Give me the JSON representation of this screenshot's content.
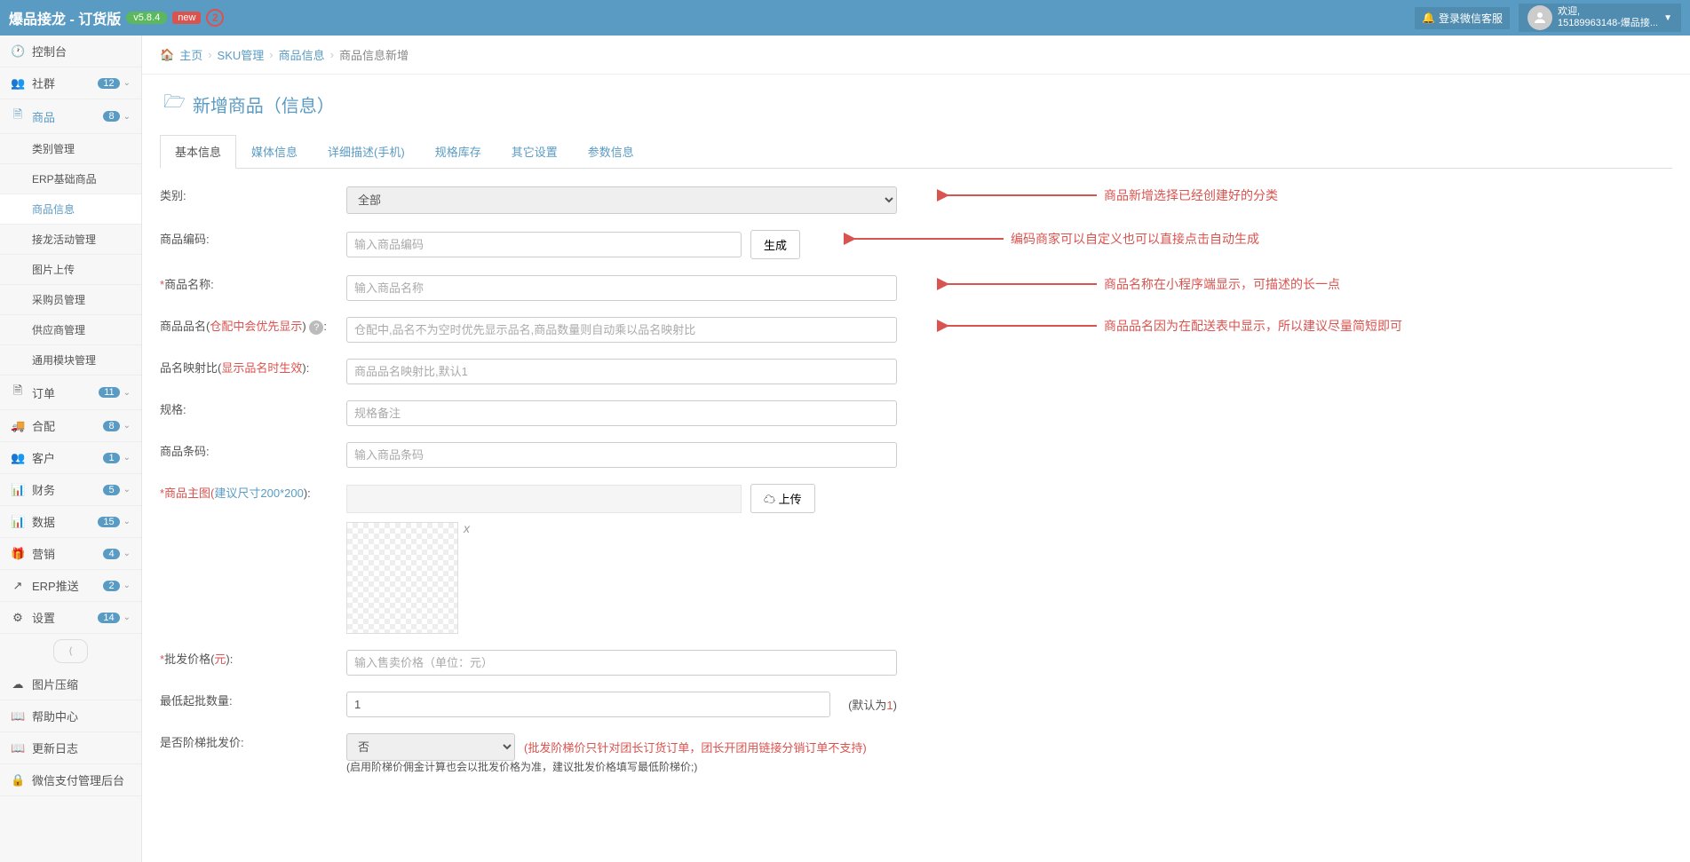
{
  "header": {
    "brand": "爆品接龙 - 订货版",
    "version": "v5.8.4",
    "new": "new",
    "notifCount": "2",
    "loginServiceBtn": "登录微信客服",
    "welcome": "欢迎,",
    "userSub": "15189963148-爆品接..."
  },
  "sidebar": {
    "items": [
      {
        "icon": "⏱",
        "label": "控制台"
      },
      {
        "icon": "👥",
        "label": "社群",
        "badge": "12"
      },
      {
        "icon": "🗎",
        "label": "商品",
        "badge": "8",
        "activeGroup": true
      },
      {
        "icon": "🗎",
        "label": "订单",
        "badge": "11"
      },
      {
        "icon": "🚚",
        "label": "合配",
        "badge": "8"
      },
      {
        "icon": "👥",
        "label": "客户",
        "badge": "1"
      },
      {
        "icon": "📊",
        "label": "财务",
        "badge": "5"
      },
      {
        "icon": "📊",
        "label": "数据",
        "badge": "15"
      },
      {
        "icon": "🎁",
        "label": "营销",
        "badge": "4"
      },
      {
        "icon": "↗",
        "label": "ERP推送",
        "badge": "2"
      },
      {
        "icon": "⚙",
        "label": "设置",
        "badge": "14"
      }
    ],
    "subItems": [
      "类别管理",
      "ERP基础商品",
      "商品信息",
      "接龙活动管理",
      "图片上传",
      "采购员管理",
      "供应商管理",
      "通用模块管理"
    ],
    "bottom": [
      {
        "icon": "☁",
        "label": "图片压缩"
      },
      {
        "icon": "📖",
        "label": "帮助中心"
      },
      {
        "icon": "📖",
        "label": "更新日志"
      },
      {
        "icon": "🔒",
        "label": "微信支付管理后台"
      }
    ]
  },
  "breadcrumb": {
    "home": "主页",
    "sku": "SKU管理",
    "product": "商品信息",
    "current": "商品信息新增"
  },
  "page": {
    "title": "新增商品（信息）"
  },
  "tabs": [
    "基本信息",
    "媒体信息",
    "详细描述(手机)",
    "规格库存",
    "其它设置",
    "参数信息"
  ],
  "form": {
    "category": {
      "label": "类别:",
      "value": "全部"
    },
    "code": {
      "label": "商品编码:",
      "placeholder": "输入商品编码",
      "button": "生成"
    },
    "name": {
      "label": "商品名称:",
      "placeholder": "输入商品名称"
    },
    "alias": {
      "labelPre": "商品品名(",
      "labelMid": "仓配中会优先显示",
      "labelPost": ")",
      "placeholder": "仓配中,品名不为空时优先显示品名,商品数量则自动乘以品名映射比"
    },
    "ratio": {
      "labelPre": "品名映射比(",
      "labelMid": "显示品名时生效",
      "labelPost": "):",
      "placeholder": "商品品名映射比,默认1"
    },
    "spec": {
      "label": "规格:",
      "placeholder": "规格备注"
    },
    "barcode": {
      "label": "商品条码:",
      "placeholder": "输入商品条码"
    },
    "mainImg": {
      "labelPre": "*商品主图(",
      "labelMid": "建议尺寸200*200",
      "labelPost": "):",
      "uploadBtn": "上传"
    },
    "wholesale": {
      "labelPre": "批发价格(",
      "unit": "元",
      "labelPost": "):",
      "placeholder": "输入售卖价格（单位：元）"
    },
    "minQty": {
      "label": "最低起批数量:",
      "value": "1",
      "hint1": "(默认为",
      "hintRed": "1",
      "hint2": ")"
    },
    "tiered": {
      "label": "是否阶梯批发价:",
      "value": "否",
      "hint": "(批发阶梯价只针对团长订货订单，团长开团用链接分销订单不支持)",
      "subHint": "(启用阶梯价佣金计算也会以批发价格为准，建议批发价格填写最低阶梯价;)"
    }
  },
  "annotations": {
    "a1": "商品新增选择已经创建好的分类",
    "a2": "编码商家可以自定义也可以直接点击自动生成",
    "a3": "商品名称在小程序端显示，可描述的长一点",
    "a4": "商品品名因为在配送表中显示，所以建议尽量简短即可"
  }
}
